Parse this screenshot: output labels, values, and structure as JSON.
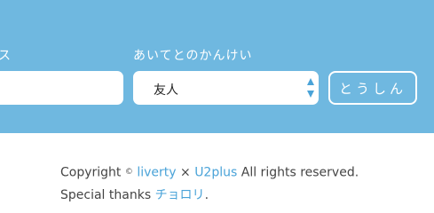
{
  "form": {
    "left_label": "ス",
    "partner_label": "あいてとのかんけい",
    "partner_select": {
      "selected": "友人"
    },
    "submit_label": "とうしん"
  },
  "footer": {
    "copyright_word": "Copyright",
    "copyright_symbol": "©",
    "link_liberty": "liverty",
    "cross": "×",
    "link_u2plus": "U2plus",
    "rights": "All rights reserved.",
    "thanks_text": "Special thanks",
    "link_thanks": "チョロリ",
    "period": "."
  },
  "colors": {
    "band": "#6fb8e0",
    "link": "#4aa3d8",
    "text": "#444444"
  }
}
